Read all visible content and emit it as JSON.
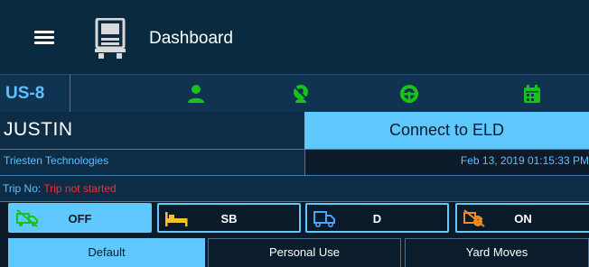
{
  "header": {
    "title": "Dashboard",
    "menu_icon": "hamburger-menu-icon",
    "logo_icon": "truck-front-icon"
  },
  "status_bar": {
    "unit": "US-8",
    "icons": [
      "driver-icon",
      "no-codriver-icon",
      "steering-wheel-icon",
      "calendar-icon"
    ],
    "icon_color": "#19c21b"
  },
  "driver": {
    "name": "JUSTIN",
    "company": "Triesten Technologies",
    "datetime": "Feb 13, 2019 01:15:33 PM"
  },
  "connect": {
    "label": "Connect to ELD"
  },
  "trip": {
    "label": "Trip No:",
    "value": "Trip not started",
    "value_color": "#ff2a2a"
  },
  "duty_status": {
    "selected": "OFF",
    "buttons": [
      {
        "label": "OFF",
        "icon": "off-duty-truck-icon"
      },
      {
        "label": "SB",
        "icon": "sleeper-berth-icon"
      },
      {
        "label": "D",
        "icon": "driving-truck-icon"
      },
      {
        "label": "ON",
        "icon": "on-duty-icon"
      }
    ]
  },
  "tabs": [
    {
      "label": "Default",
      "active": true
    },
    {
      "label": "Personal Use",
      "active": false
    },
    {
      "label": "Yard Moves",
      "active": false
    }
  ],
  "colors": {
    "accent": "#5fc8ff",
    "background": "#0d1a2a",
    "header": "#0a2a40"
  }
}
